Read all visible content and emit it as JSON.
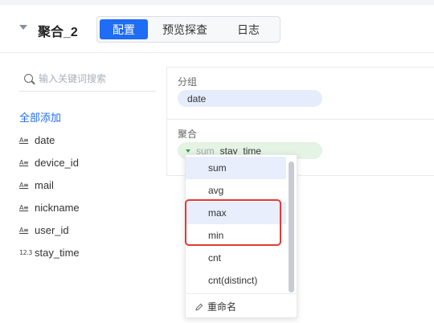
{
  "header": {
    "title": "聚合_2",
    "tabs": [
      {
        "label": "配置",
        "active": true
      },
      {
        "label": "预览探查",
        "active": false
      },
      {
        "label": "日志",
        "active": false
      }
    ]
  },
  "left": {
    "search_placeholder": "输入关键词搜索",
    "add_all_label": "全部添加",
    "fields": [
      {
        "type_icon": "A≡",
        "name": "date"
      },
      {
        "type_icon": "A≡",
        "name": "device_id"
      },
      {
        "type_icon": "A≡",
        "name": "mail"
      },
      {
        "type_icon": "A≡",
        "name": "nickname"
      },
      {
        "type_icon": "A≡",
        "name": "user_id"
      },
      {
        "type_icon": "12.3",
        "name": "stay_time"
      }
    ]
  },
  "right": {
    "group_label": "分组",
    "group_field": "date",
    "agg_label": "聚合",
    "agg_function": "sum",
    "agg_field": "stay_time"
  },
  "dropdown": {
    "options": [
      "sum",
      "avg",
      "max",
      "min",
      "cnt",
      "cnt(distinct)"
    ],
    "rename_label": "重命名"
  },
  "colors": {
    "accent": "#1f6cf5",
    "highlight_box": "#e53935",
    "group_pill": "#e5ecfb",
    "agg_pill": "#e4f3e4"
  }
}
